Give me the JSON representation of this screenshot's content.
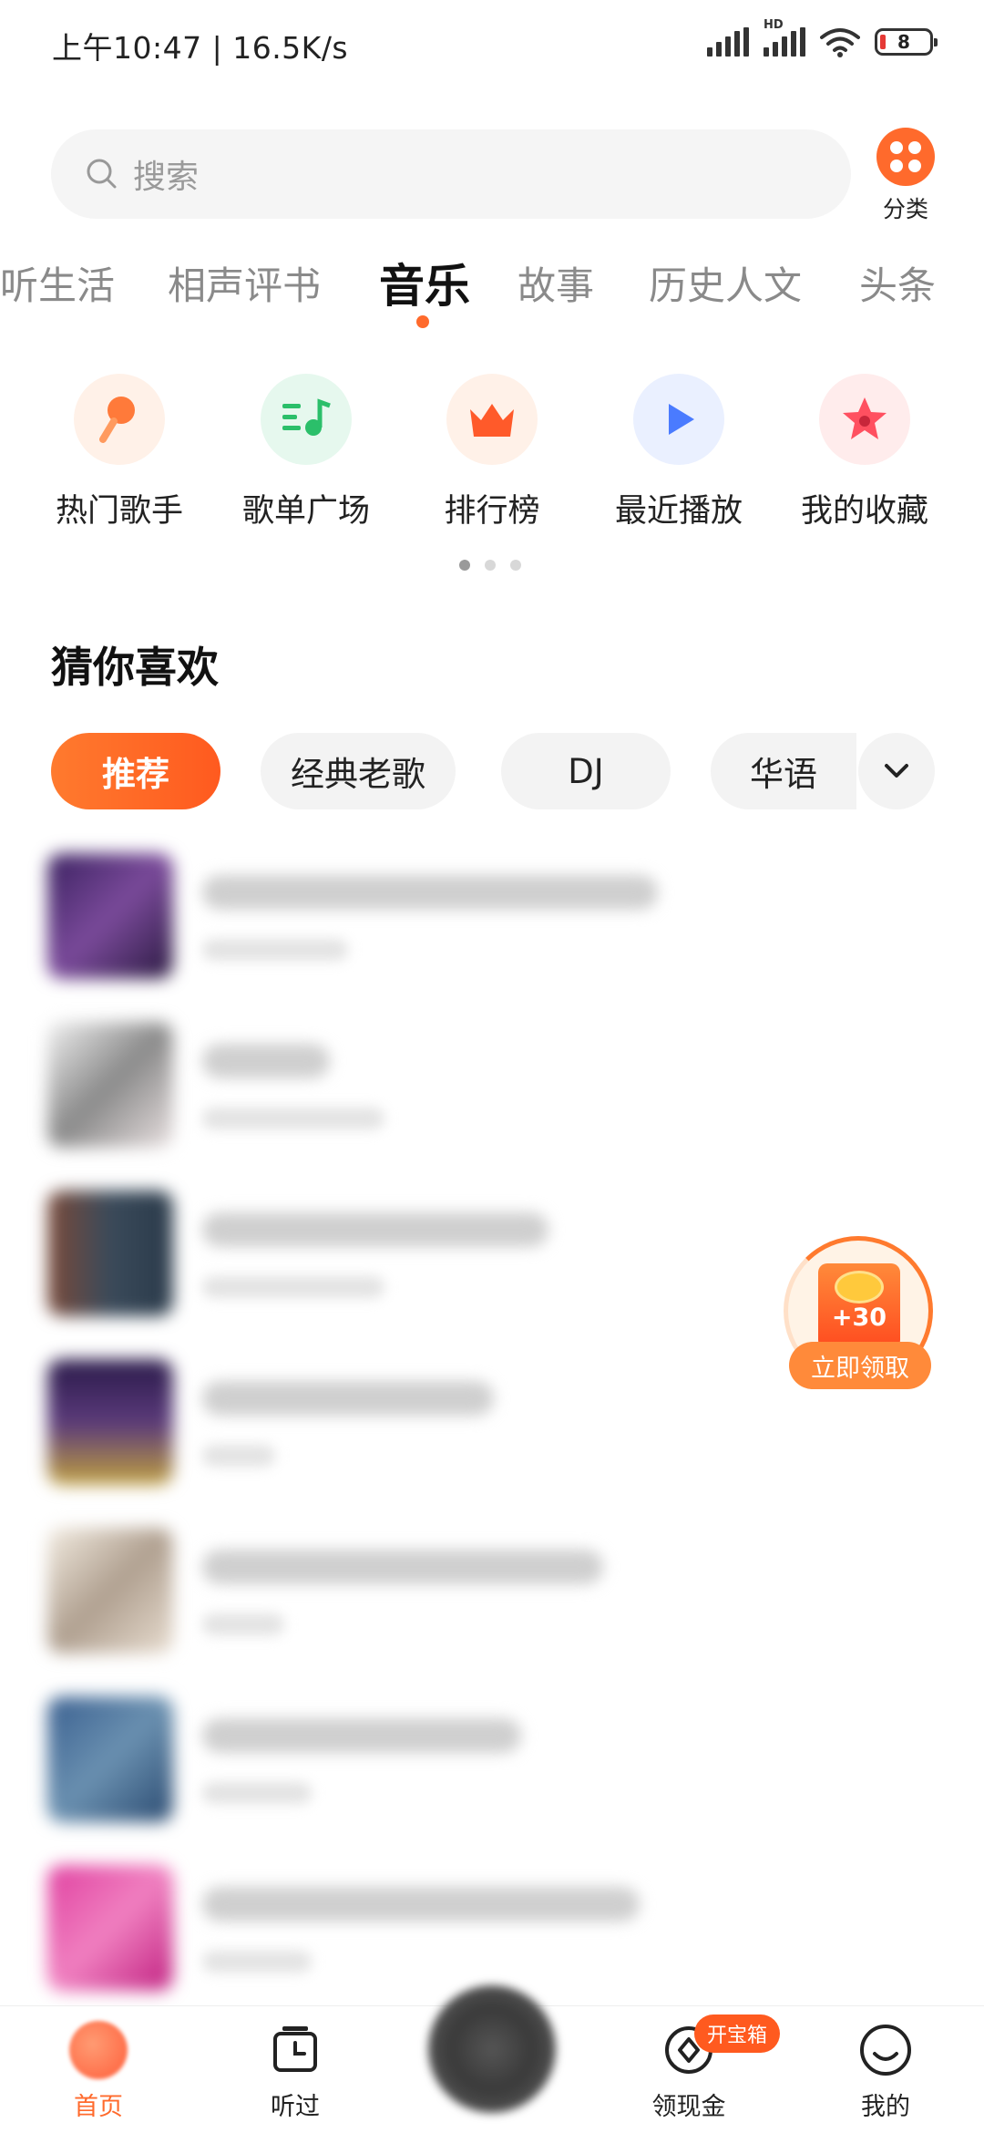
{
  "status_bar": {
    "time": "上午10:47 | 16.5K/s",
    "battery": "8"
  },
  "search": {
    "placeholder": "搜索"
  },
  "category_button": {
    "label": "分类"
  },
  "tabs": [
    {
      "label": "听生活"
    },
    {
      "label": "相声评书"
    },
    {
      "label": "音乐",
      "active": true
    },
    {
      "label": "故事"
    },
    {
      "label": "历史人文"
    },
    {
      "label": "头条"
    }
  ],
  "shortcuts": [
    {
      "label": "热门歌手",
      "icon": "microphone-icon"
    },
    {
      "label": "歌单广场",
      "icon": "playlist-icon"
    },
    {
      "label": "排行榜",
      "icon": "crown-icon"
    },
    {
      "label": "最近播放",
      "icon": "play-icon"
    },
    {
      "label": "我的收藏",
      "icon": "star-icon"
    }
  ],
  "section": {
    "title": "猜你喜欢"
  },
  "filter_chips": [
    {
      "label": "推荐",
      "active": true
    },
    {
      "label": "经典老歌"
    },
    {
      "label": "DJ"
    },
    {
      "label": "华语"
    }
  ],
  "reward": {
    "amount": "+30",
    "button_label": "立即领取"
  },
  "bottom_nav": [
    {
      "label": "首页",
      "active": true
    },
    {
      "label": "听过"
    },
    {
      "label": "领现金",
      "badge": "开宝箱"
    },
    {
      "label": "我的"
    }
  ],
  "colors": {
    "accent": "#ff6a2c"
  }
}
